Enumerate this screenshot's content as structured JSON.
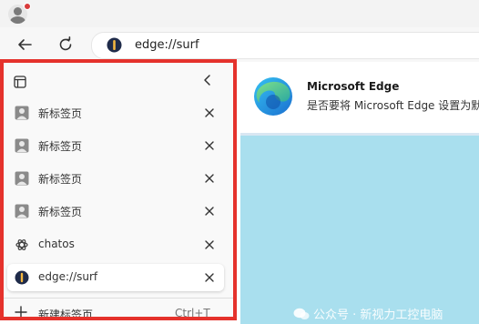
{
  "browser": {
    "address": {
      "url": "edge://surf"
    }
  },
  "sidebar": {
    "tabs": [
      {
        "label": "新标签页",
        "icon": "newtab-person-icon",
        "active": false
      },
      {
        "label": "新标签页",
        "icon": "newtab-person-icon",
        "active": false
      },
      {
        "label": "新标签页",
        "icon": "newtab-person-icon",
        "active": false
      },
      {
        "label": "新标签页",
        "icon": "newtab-person-icon",
        "active": false
      },
      {
        "label": "chatos",
        "icon": "openai-icon",
        "active": false
      },
      {
        "label": "edge://surf",
        "icon": "surf-icon",
        "active": true
      }
    ],
    "new_tab": {
      "label": "新建标签页",
      "shortcut": "Ctrl+T"
    }
  },
  "notification": {
    "title": "Microsoft Edge",
    "body": "是否要将 Microsoft Edge 设置为默认"
  },
  "watermark": {
    "text": "公众号 · 新视力工控电脑"
  },
  "colors": {
    "highlight_border": "#e5322c",
    "content_bg": "#a9dfee",
    "edge_blue": "#1b7bd8",
    "edge_green": "#42c06a"
  }
}
